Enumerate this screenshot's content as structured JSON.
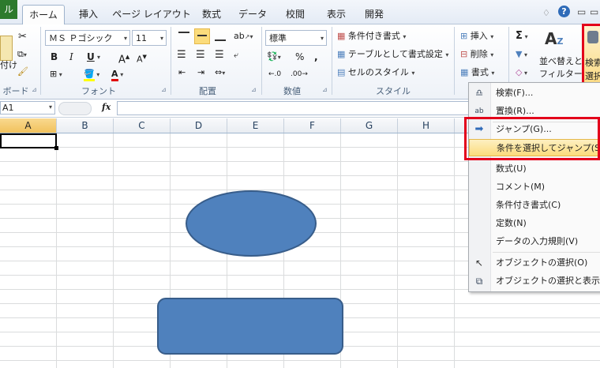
{
  "tabs": {
    "file": "ル",
    "home": "ホーム",
    "insert": "挿入",
    "page_layout": "ページ レイアウト",
    "formulas": "数式",
    "data": "データ",
    "review": "校閲",
    "view": "表示",
    "developer": "開発"
  },
  "clipboard": {
    "paste": "付け",
    "label": "ボード"
  },
  "font": {
    "name": "ＭＳ Ｐゴシック",
    "size": "11",
    "label": "フォント",
    "bold": "B",
    "italic": "I",
    "underline": "U",
    "grow": "A",
    "shrink": "A",
    "color_letter": "A"
  },
  "alignment": {
    "label": "配置"
  },
  "number": {
    "format": "標準",
    "label": "数値",
    "percent": "%",
    "comma": ","
  },
  "styles": {
    "conditional": "条件付き書式",
    "table": "テーブルとして書式設定",
    "cell_style": "セルのスタイル",
    "label": "スタイル"
  },
  "cells": {
    "insert": "挿入",
    "delete": "削除",
    "format": "書式"
  },
  "editing": {
    "sum": "Σ",
    "sort_line1": "並べ替えと",
    "sort_line2": "フィルター",
    "find_line1": "検索",
    "find_line2": "選択"
  },
  "formula_bar": {
    "name_box": "A1",
    "fx": "fx"
  },
  "columns": [
    "A",
    "B",
    "C",
    "D",
    "E",
    "F",
    "G",
    "H"
  ],
  "menu": {
    "items": [
      {
        "label": "検索(F)...",
        "icon": "binoculars-icon"
      },
      {
        "label": "置換(R)...",
        "icon": "replace-icon"
      },
      {
        "label": "ジャンプ(G)...",
        "icon": "arrow-right-icon"
      },
      {
        "label": "条件を選択してジャンプ(S)...",
        "icon": ""
      },
      {
        "label": "数式(U)",
        "icon": ""
      },
      {
        "label": "コメント(M)",
        "icon": ""
      },
      {
        "label": "条件付き書式(C)",
        "icon": ""
      },
      {
        "label": "定数(N)",
        "icon": ""
      },
      {
        "label": "データの入力規則(V)",
        "icon": ""
      },
      {
        "label": "オブジェクトの選択(O)",
        "icon": "pointer-icon"
      },
      {
        "label": "オブジェクトの選択と表示(P)...",
        "icon": "selection-pane-icon"
      }
    ]
  },
  "colors": {
    "shape_fill": "#4f81bd",
    "shape_stroke": "#385d8a",
    "highlight_box": "#e3001b",
    "file_tab": "#2d7a2d"
  }
}
